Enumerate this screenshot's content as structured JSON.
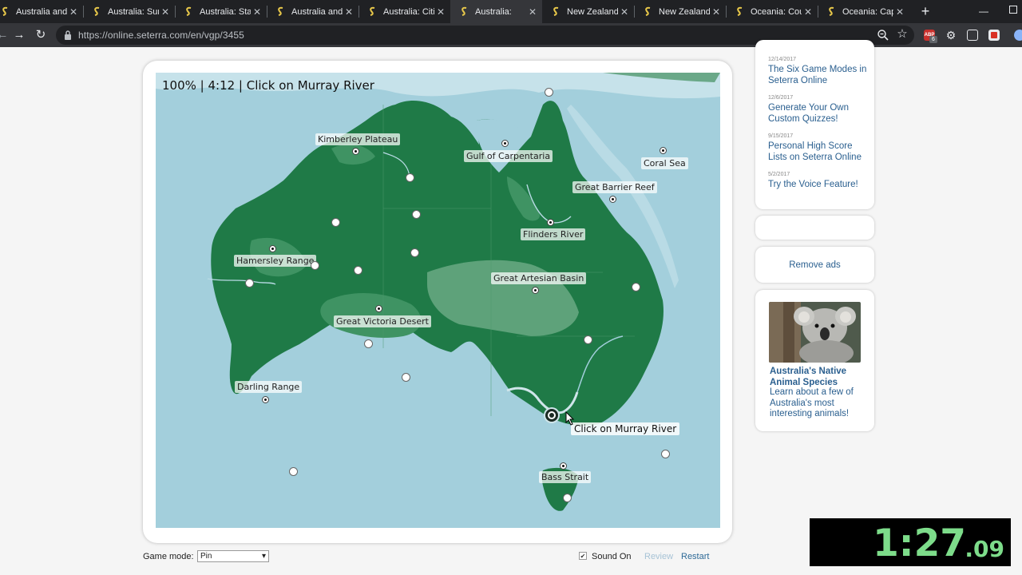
{
  "browser": {
    "tabs": [
      {
        "title": "Australia and",
        "active": false
      },
      {
        "title": "Australia: Sur",
        "active": false
      },
      {
        "title": "Australia: Stat",
        "active": false
      },
      {
        "title": "Australia and",
        "active": false
      },
      {
        "title": "Australia: Citi",
        "active": false
      },
      {
        "title": "Australia:",
        "active": true
      },
      {
        "title": "New Zealand:",
        "active": false
      },
      {
        "title": "New Zealand:",
        "active": false
      },
      {
        "title": "Oceania: Cou",
        "active": false
      },
      {
        "title": "Oceania: Cap",
        "active": false
      }
    ],
    "url": "https://online.seterra.com/en/vgp/3455",
    "new_tab_glyph": "+",
    "ext_abp_label": "ABP",
    "ext_badge": "6",
    "colors": {
      "tabbar": "#202124",
      "toolbar": "#35363a",
      "favicon": "#e8c84a"
    }
  },
  "game": {
    "status": "100% | 4:12 | Click on Murray River",
    "tooltip": "Click on Murray River",
    "labels": {
      "kimberley_plateau": "Kimberley Plateau",
      "gulf_of_carpentaria": "Gulf of Carpentaria",
      "coral_sea": "Coral Sea",
      "great_barrier_reef": "Great Barrier Reef",
      "flinders_river": "Flinders River",
      "hamersley_range": "Hamersley Range",
      "great_artesian_basin": "Great Artesian Basin",
      "great_victoria_desert": "Great Victoria Desert",
      "darling_range": "Darling Range",
      "bass_strait": "Bass Strait"
    },
    "colors": {
      "sea": "#a3cfdc",
      "land": "#1f7a47",
      "land_light": "#3f9363",
      "basin": "#5ea27a",
      "highlight": "#cfe5ea"
    }
  },
  "controls": {
    "game_mode_label": "Game mode:",
    "game_mode_value": "Pin",
    "sound_label": "Sound On",
    "sound_checked_glyph": "✔",
    "review_label": "Review",
    "restart_label": "Restart"
  },
  "sidebar": {
    "news": [
      {
        "date": "12/14/2017",
        "title": "The Six Game Modes in Seterra Online"
      },
      {
        "date": "12/6/2017",
        "title": "Generate Your Own Custom Quizzes!"
      },
      {
        "date": "9/15/2017",
        "title": "Personal High Score Lists on Seterra Online"
      },
      {
        "date": "5/2/2017",
        "title": "Try the Voice Feature!"
      }
    ],
    "remove_ads": "Remove ads",
    "species_title": "Australia's Native Animal Species",
    "species_desc": "Learn about a few of Australia's most interesting animals!"
  },
  "timer": {
    "main": "1:27",
    "fraction": ".09"
  }
}
